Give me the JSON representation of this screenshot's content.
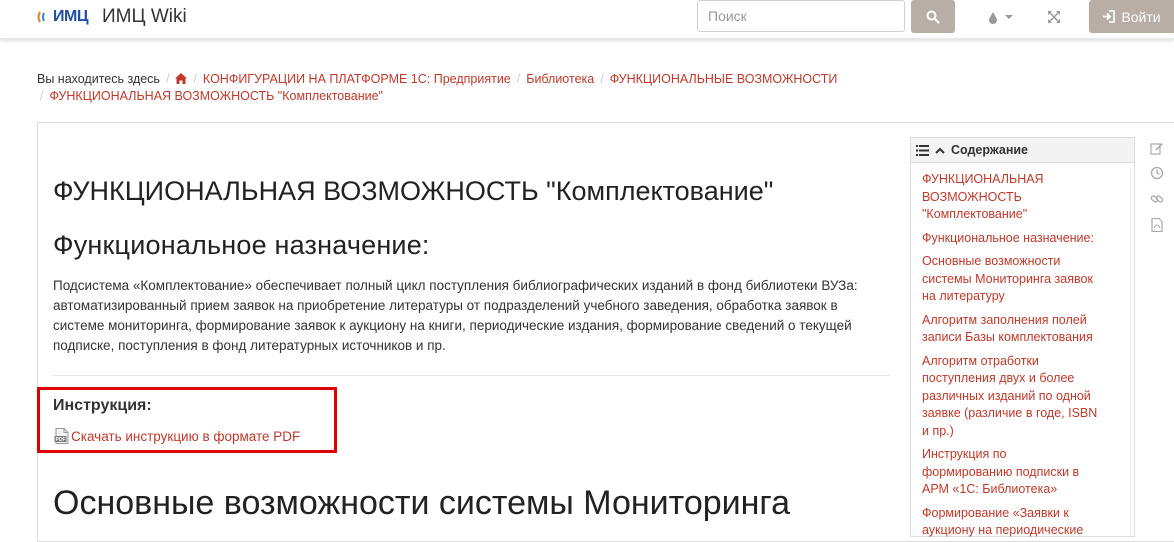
{
  "header": {
    "logo_text": "ИМЦ",
    "title": "ИМЦ Wiki",
    "search_placeholder": "Поиск",
    "login_label": "Войти",
    "icons": [
      "search-icon",
      "drop-icon",
      "caret-down-icon",
      "fullscreen-icon",
      "sign-in-icon"
    ]
  },
  "breadcrumb": {
    "prefix": "Вы находитесь здесь",
    "items": [
      "КОНФИГУРАЦИИ НА ПЛАТФОРМЕ 1С: Предприятие",
      "Библиотека",
      "ФУНКЦИОНАЛЬНЫЕ ВОЗМОЖНОСТИ",
      "ФУНКЦИОНАЛЬНАЯ ВОЗМОЖНОСТЬ \"Комплектование\""
    ]
  },
  "content": {
    "title": "ФУНКЦИОНАЛЬНАЯ ВОЗМОЖНОСТЬ \"Комплектование\"",
    "section_title": "Функциональное назначение:",
    "body": "Подсистема «Комплектование» обеспечивает полный цикл поступления библиографических изданий в фонд библиотеки ВУЗа: автоматизированный прием заявок на приобретение литературы от подразделений учебного заведения, обработка заявок в системе мониторинга, формирование заявок к аукциону на книги, периодические издания, формирование сведений о текущей подписке, поступления в фонд литературных источников и пр.",
    "instruction_title": "Инструкция:",
    "instruction_link": "Скачать инструкцию в формате PDF",
    "next_heading": "Основные возможности системы Мониторинга"
  },
  "toc": {
    "header": "Содержание",
    "items": [
      "ФУНКЦИОНАЛЬНАЯ ВОЗМОЖНОСТЬ \"Комплектование\"",
      "Функциональное назначение:",
      "Основные возможности системы Мониторинга заявок на литературу",
      "Алгоритм заполнения полей записи Базы комплектования",
      "Алгоритм отработки поступления двух и более различных изданий по одной заявке (различие в годе, ISBN и пр.)",
      "Инструкция по формированию подписки в АРМ «1С: Библиотека»",
      "Формирование «Заявки к аукциону на периодические"
    ]
  },
  "colors": {
    "link": "#c0392b",
    "button_bg": "#b9aea6",
    "highlight_border": "#e00000"
  }
}
